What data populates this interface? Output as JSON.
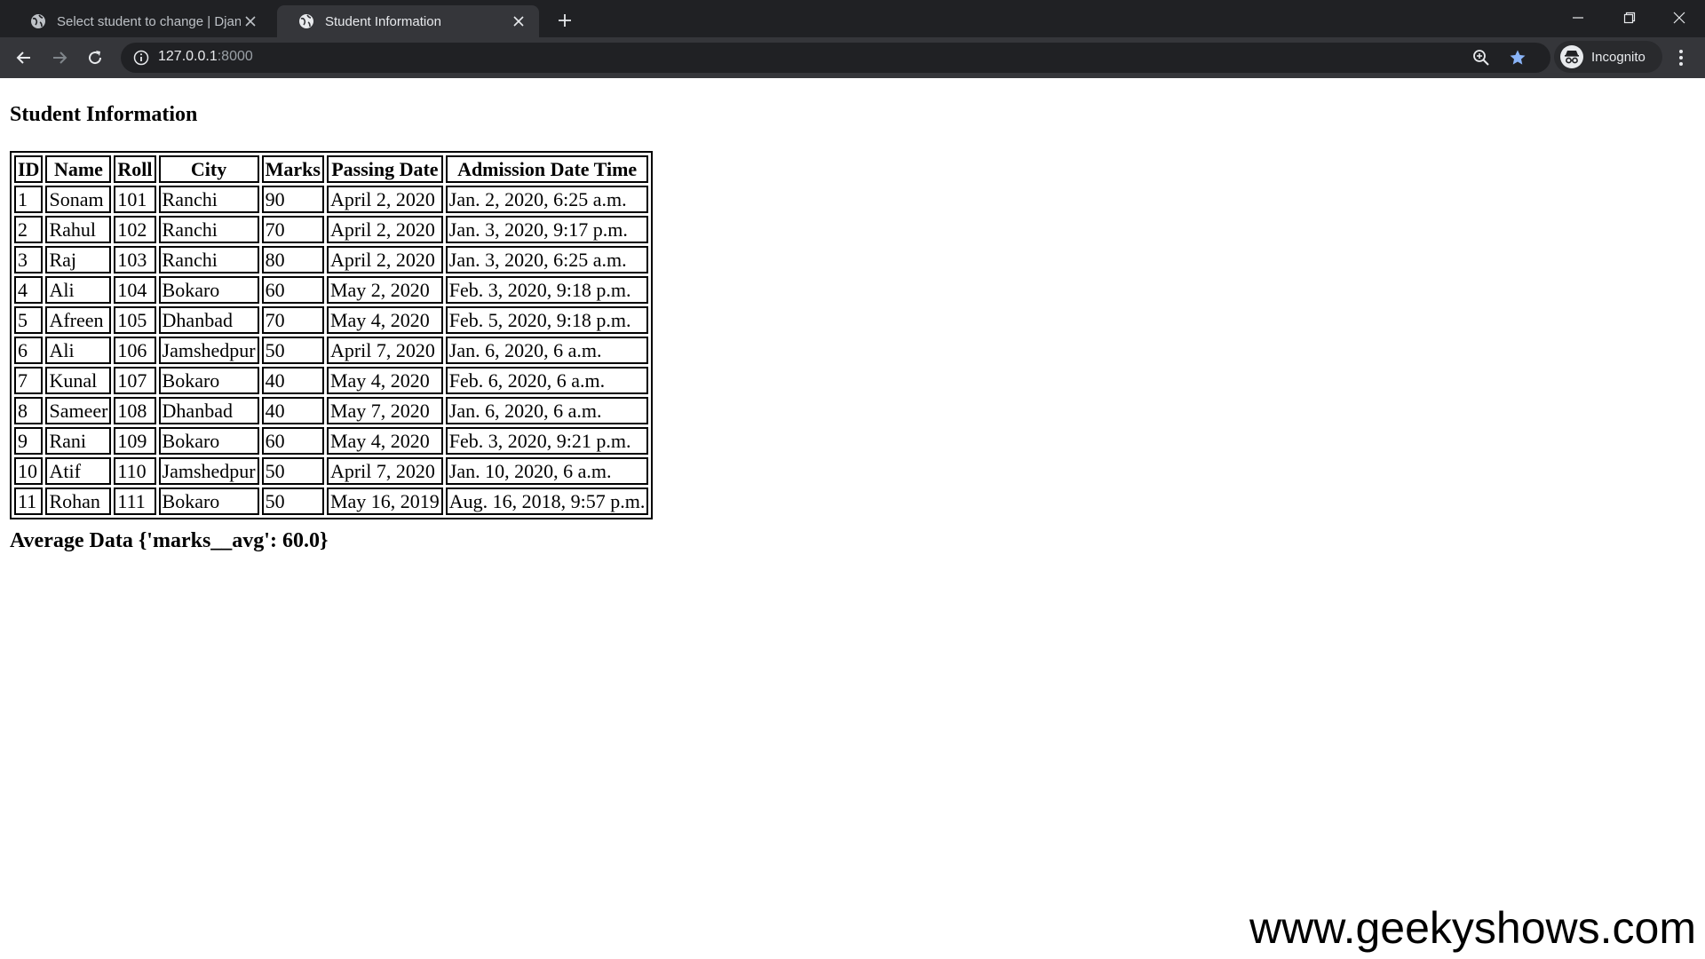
{
  "browser": {
    "tabs": [
      {
        "title": "Select student to change | Djang",
        "active": false
      },
      {
        "title": "Student Information",
        "active": true
      }
    ],
    "address": {
      "host": "127.0.0.1",
      "port": ":8000"
    },
    "profile_label": "Incognito",
    "accent_color": "#8ab4f8"
  },
  "page": {
    "heading": "Student Information",
    "table": {
      "columns": [
        "ID",
        "Name",
        "Roll",
        "City",
        "Marks",
        "Passing Date",
        "Admission Date Time"
      ],
      "rows": [
        [
          "1",
          "Sonam",
          "101",
          "Ranchi",
          "90",
          "April 2, 2020",
          "Jan. 2, 2020, 6:25 a.m."
        ],
        [
          "2",
          "Rahul",
          "102",
          "Ranchi",
          "70",
          "April 2, 2020",
          "Jan. 3, 2020, 9:17 p.m."
        ],
        [
          "3",
          "Raj",
          "103",
          "Ranchi",
          "80",
          "April 2, 2020",
          "Jan. 3, 2020, 6:25 a.m."
        ],
        [
          "4",
          "Ali",
          "104",
          "Bokaro",
          "60",
          "May 2, 2020",
          "Feb. 3, 2020, 9:18 p.m."
        ],
        [
          "5",
          "Afreen",
          "105",
          "Dhanbad",
          "70",
          "May 4, 2020",
          "Feb. 5, 2020, 9:18 p.m."
        ],
        [
          "6",
          "Ali",
          "106",
          "Jamshedpur",
          "50",
          "April 7, 2020",
          "Jan. 6, 2020, 6 a.m."
        ],
        [
          "7",
          "Kunal",
          "107",
          "Bokaro",
          "40",
          "May 4, 2020",
          "Feb. 6, 2020, 6 a.m."
        ],
        [
          "8",
          "Sameer",
          "108",
          "Dhanbad",
          "40",
          "May 7, 2020",
          "Jan. 6, 2020, 6 a.m."
        ],
        [
          "9",
          "Rani",
          "109",
          "Bokaro",
          "60",
          "May 4, 2020",
          "Feb. 3, 2020, 9:21 p.m."
        ],
        [
          "10",
          "Atif",
          "110",
          "Jamshedpur",
          "50",
          "April 7, 2020",
          "Jan. 10, 2020, 6 a.m."
        ],
        [
          "11",
          "Rohan",
          "111",
          "Bokaro",
          "50",
          "May 16, 2019",
          "Aug. 16, 2018, 9:57 p.m."
        ]
      ]
    },
    "average": "Average Data {'marks__avg': 60.0}"
  },
  "watermark": "www.geekyshows.com"
}
